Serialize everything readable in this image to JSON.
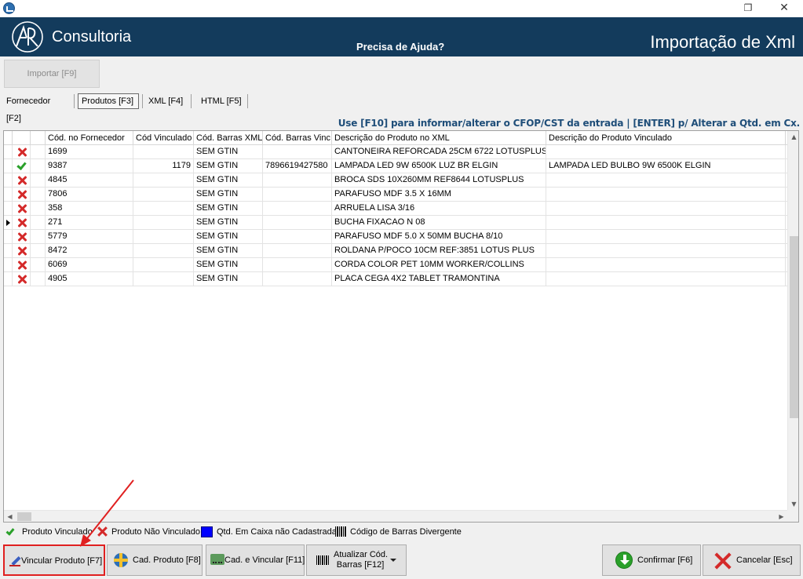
{
  "window": {
    "restore_glyph": "❐",
    "close_glyph": "✕"
  },
  "header": {
    "brand": "Consultoria",
    "help_link": "Precisa de Ajuda?",
    "title": "Importação de Xml"
  },
  "toolbar": {
    "import_label": "Importar [F9]"
  },
  "tabs": [
    {
      "label": "Fornecedor [F2]",
      "active": false
    },
    {
      "label": "Produtos [F3]",
      "active": true
    },
    {
      "label": "XML [F4]",
      "active": false
    },
    {
      "label": "HTML [F5]",
      "active": false
    }
  ],
  "hint": "Use [F10] para informar/alterar o CFOP/CST da entrada | [ENTER] p/ Alterar a Qtd. em Cx.",
  "grid": {
    "columns": [
      "Cód. no Fornecedor",
      "Cód Vinculado",
      "Cód. Barras XML",
      "Cód. Barras Vinc.",
      "Descrição do Produto no XML",
      "Descrição do Produto Vinculado"
    ],
    "rows": [
      {
        "status": "x",
        "cod_fornecedor": "1699",
        "cod_vinculado": "",
        "barras_xml": "SEM GTIN",
        "barras_vinc": "",
        "desc_xml": "CANTONEIRA REFORCADA 25CM 6722 LOTUSPLUS",
        "desc_vinc": ""
      },
      {
        "status": "check",
        "cod_fornecedor": "9387",
        "cod_vinculado": "1179",
        "barras_xml": "SEM GTIN",
        "barras_vinc": "7896619427580",
        "desc_xml": "LAMPADA LED 9W 6500K LUZ BR ELGIN",
        "desc_vinc": "LAMPADA LED BULBO 9W 6500K ELGIN"
      },
      {
        "status": "x",
        "cod_fornecedor": "4845",
        "cod_vinculado": "",
        "barras_xml": "SEM GTIN",
        "barras_vinc": "",
        "desc_xml": "BROCA SDS 10X260MM REF8644 LOTUSPLUS",
        "desc_vinc": ""
      },
      {
        "status": "x",
        "cod_fornecedor": "7806",
        "cod_vinculado": "",
        "barras_xml": "SEM GTIN",
        "barras_vinc": "",
        "desc_xml": "PARAFUSO MDF 3.5 X 16MM",
        "desc_vinc": ""
      },
      {
        "status": "x",
        "cod_fornecedor": "358",
        "cod_vinculado": "",
        "barras_xml": "SEM GTIN",
        "barras_vinc": "",
        "desc_xml": "ARRUELA LISA 3/16",
        "desc_vinc": ""
      },
      {
        "status": "x",
        "cod_fornecedor": "271",
        "cod_vinculado": "",
        "barras_xml": "SEM GTIN",
        "barras_vinc": "",
        "desc_xml": "BUCHA FIXACAO N 08",
        "desc_vinc": "",
        "current": true
      },
      {
        "status": "x",
        "cod_fornecedor": "5779",
        "cod_vinculado": "",
        "barras_xml": "SEM GTIN",
        "barras_vinc": "",
        "desc_xml": "PARAFUSO MDF 5.0 X 50MM BUCHA 8/10",
        "desc_vinc": ""
      },
      {
        "status": "x",
        "cod_fornecedor": "8472",
        "cod_vinculado": "",
        "barras_xml": "SEM GTIN",
        "barras_vinc": "",
        "desc_xml": "ROLDANA P/POCO 10CM REF:3851 LOTUS PLUS",
        "desc_vinc": ""
      },
      {
        "status": "x",
        "cod_fornecedor": "6069",
        "cod_vinculado": "",
        "barras_xml": "SEM GTIN",
        "barras_vinc": "",
        "desc_xml": "CORDA COLOR PET 10MM WORKER/COLLINS",
        "desc_vinc": ""
      },
      {
        "status": "x",
        "cod_fornecedor": "4905",
        "cod_vinculado": "",
        "barras_xml": "SEM GTIN",
        "barras_vinc": "",
        "desc_xml": "PLACA CEGA 4X2 TABLET TRAMONTINA",
        "desc_vinc": ""
      }
    ]
  },
  "legend": {
    "vinculado": "Produto Vinculado",
    "nao_vinculado": "Produto Não Vinculado",
    "qtd_caixa": "Qtd. Em Caixa não Cadastrada",
    "barras_divergente": "Código de Barras Divergente"
  },
  "buttons": {
    "vincular": "Vincular Produto [F7]",
    "cad_produto": "Cad. Produto [F8]",
    "cad_vincular": "Cad. e Vincular [F11]",
    "atualizar_line1": "Atualizar Cód.",
    "atualizar_line2": "Barras [F12]",
    "confirmar": "Confirmar [F6]",
    "cancelar": "Cancelar [Esc]"
  },
  "colors": {
    "header_bg": "#133b5c",
    "hint_text": "#1f4e79",
    "linked": "#2aa02a",
    "unlinked": "#d42a2a",
    "annotation": "#e02020"
  }
}
